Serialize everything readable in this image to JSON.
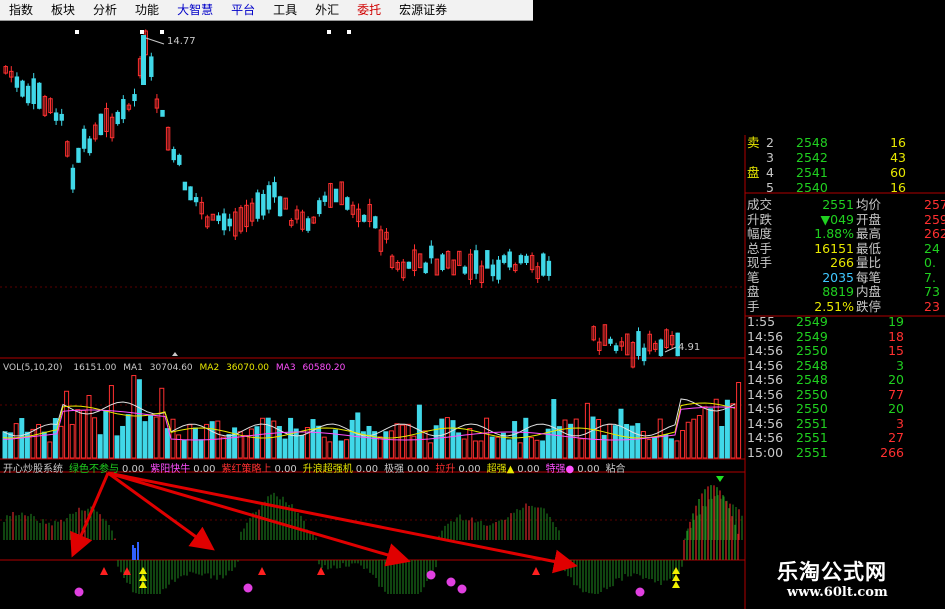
{
  "menu": [
    {
      "label": "指数",
      "color": "black"
    },
    {
      "label": "板块",
      "color": "black"
    },
    {
      "label": "分析",
      "color": "black"
    },
    {
      "label": "功能",
      "color": "black"
    },
    {
      "label": "大智慧",
      "color": "blue"
    },
    {
      "label": "平台",
      "color": "blue"
    },
    {
      "label": "工具",
      "color": "black"
    },
    {
      "label": "外汇",
      "color": "black"
    },
    {
      "label": "委托",
      "color": "red"
    },
    {
      "label": "宏源证券",
      "color": "black"
    }
  ],
  "price_chart": {
    "high_label": "14.77",
    "low_label": "4.91"
  },
  "volume_legend": {
    "name": "VOL(5,10,20)",
    "vol": "16151.00",
    "ma1_label": "MA1",
    "ma1": "30704.60",
    "ma2_label": "MA2",
    "ma2": "36070.00",
    "ma3_label": "MA3",
    "ma3": "60580.20"
  },
  "indicator_legend": {
    "name": "开心炒股系统",
    "items": [
      {
        "label": "绿色不参与",
        "value": "0.00"
      },
      {
        "label": "紫阳快牛",
        "value": "0.00"
      },
      {
        "label": "紫红策略上",
        "value": "0.00"
      },
      {
        "label": "升浪超强机",
        "value": "0.00"
      },
      {
        "label": "极强",
        "value": "0.00"
      },
      {
        "label": "拉升",
        "value": "0.00"
      },
      {
        "label": "超强▲",
        "value": "0.00"
      },
      {
        "label": "特强●",
        "value": "0.00"
      },
      {
        "label": "粘合",
        "value": ""
      }
    ]
  },
  "order_book": [
    {
      "side": "卖",
      "level": "2",
      "price": "2548",
      "volume": "16"
    },
    {
      "side": "",
      "level": "3",
      "price": "2542",
      "volume": "43"
    },
    {
      "side": "盘",
      "level": "4",
      "price": "2541",
      "volume": "60"
    },
    {
      "side": "",
      "level": "5",
      "price": "2540",
      "volume": "16"
    }
  ],
  "stats": [
    {
      "label": "成交",
      "value": "2551",
      "label2": "均价",
      "value2": "257"
    },
    {
      "label": "升跌",
      "value": "▼049",
      "label2": "开盘",
      "value2": "259"
    },
    {
      "label": "幅度",
      "value": "1.88%",
      "label2": "最高",
      "value2": "262"
    },
    {
      "label": "总手",
      "value": "16151",
      "label2": "最低",
      "value2": "24"
    },
    {
      "label": "现手",
      "value": "266",
      "label2": "量比",
      "value2": "0."
    },
    {
      "label": "笔",
      "value": "2035",
      "label2": "每笔",
      "value2": "7."
    },
    {
      "label": "盘",
      "value": "8819",
      "label2": "内盘",
      "value2": "73"
    },
    {
      "label": "手",
      "value": "2.51%",
      "label2": "跌停",
      "value2": "23"
    }
  ],
  "trades": [
    {
      "time": "1:55",
      "price": "2549",
      "vol": "19",
      "dir": "g"
    },
    {
      "time": "14:56",
      "price": "2549",
      "vol": "18",
      "dir": "r"
    },
    {
      "time": "14:56",
      "price": "2550",
      "vol": "15",
      "dir": "r"
    },
    {
      "time": "14:56",
      "price": "2548",
      "vol": "3",
      "dir": "g"
    },
    {
      "time": "14:56",
      "price": "2548",
      "vol": "20",
      "dir": "g"
    },
    {
      "time": "14:56",
      "price": "2550",
      "vol": "77",
      "dir": "r"
    },
    {
      "time": "14:56",
      "price": "2550",
      "vol": "20",
      "dir": "g"
    },
    {
      "time": "14:56",
      "price": "2551",
      "vol": "3",
      "dir": "r"
    },
    {
      "time": "14:56",
      "price": "2551",
      "vol": "27",
      "dir": "r"
    },
    {
      "time": "15:00",
      "price": "2551",
      "vol": "266",
      "dir": "r"
    }
  ],
  "watermark": {
    "title": "乐淘公式网",
    "url": "www.60lt.com"
  },
  "colors": {
    "up": "#ff3030",
    "down": "#40d8e8",
    "grid": "#b00000",
    "bull_arrow": "#e00000"
  }
}
